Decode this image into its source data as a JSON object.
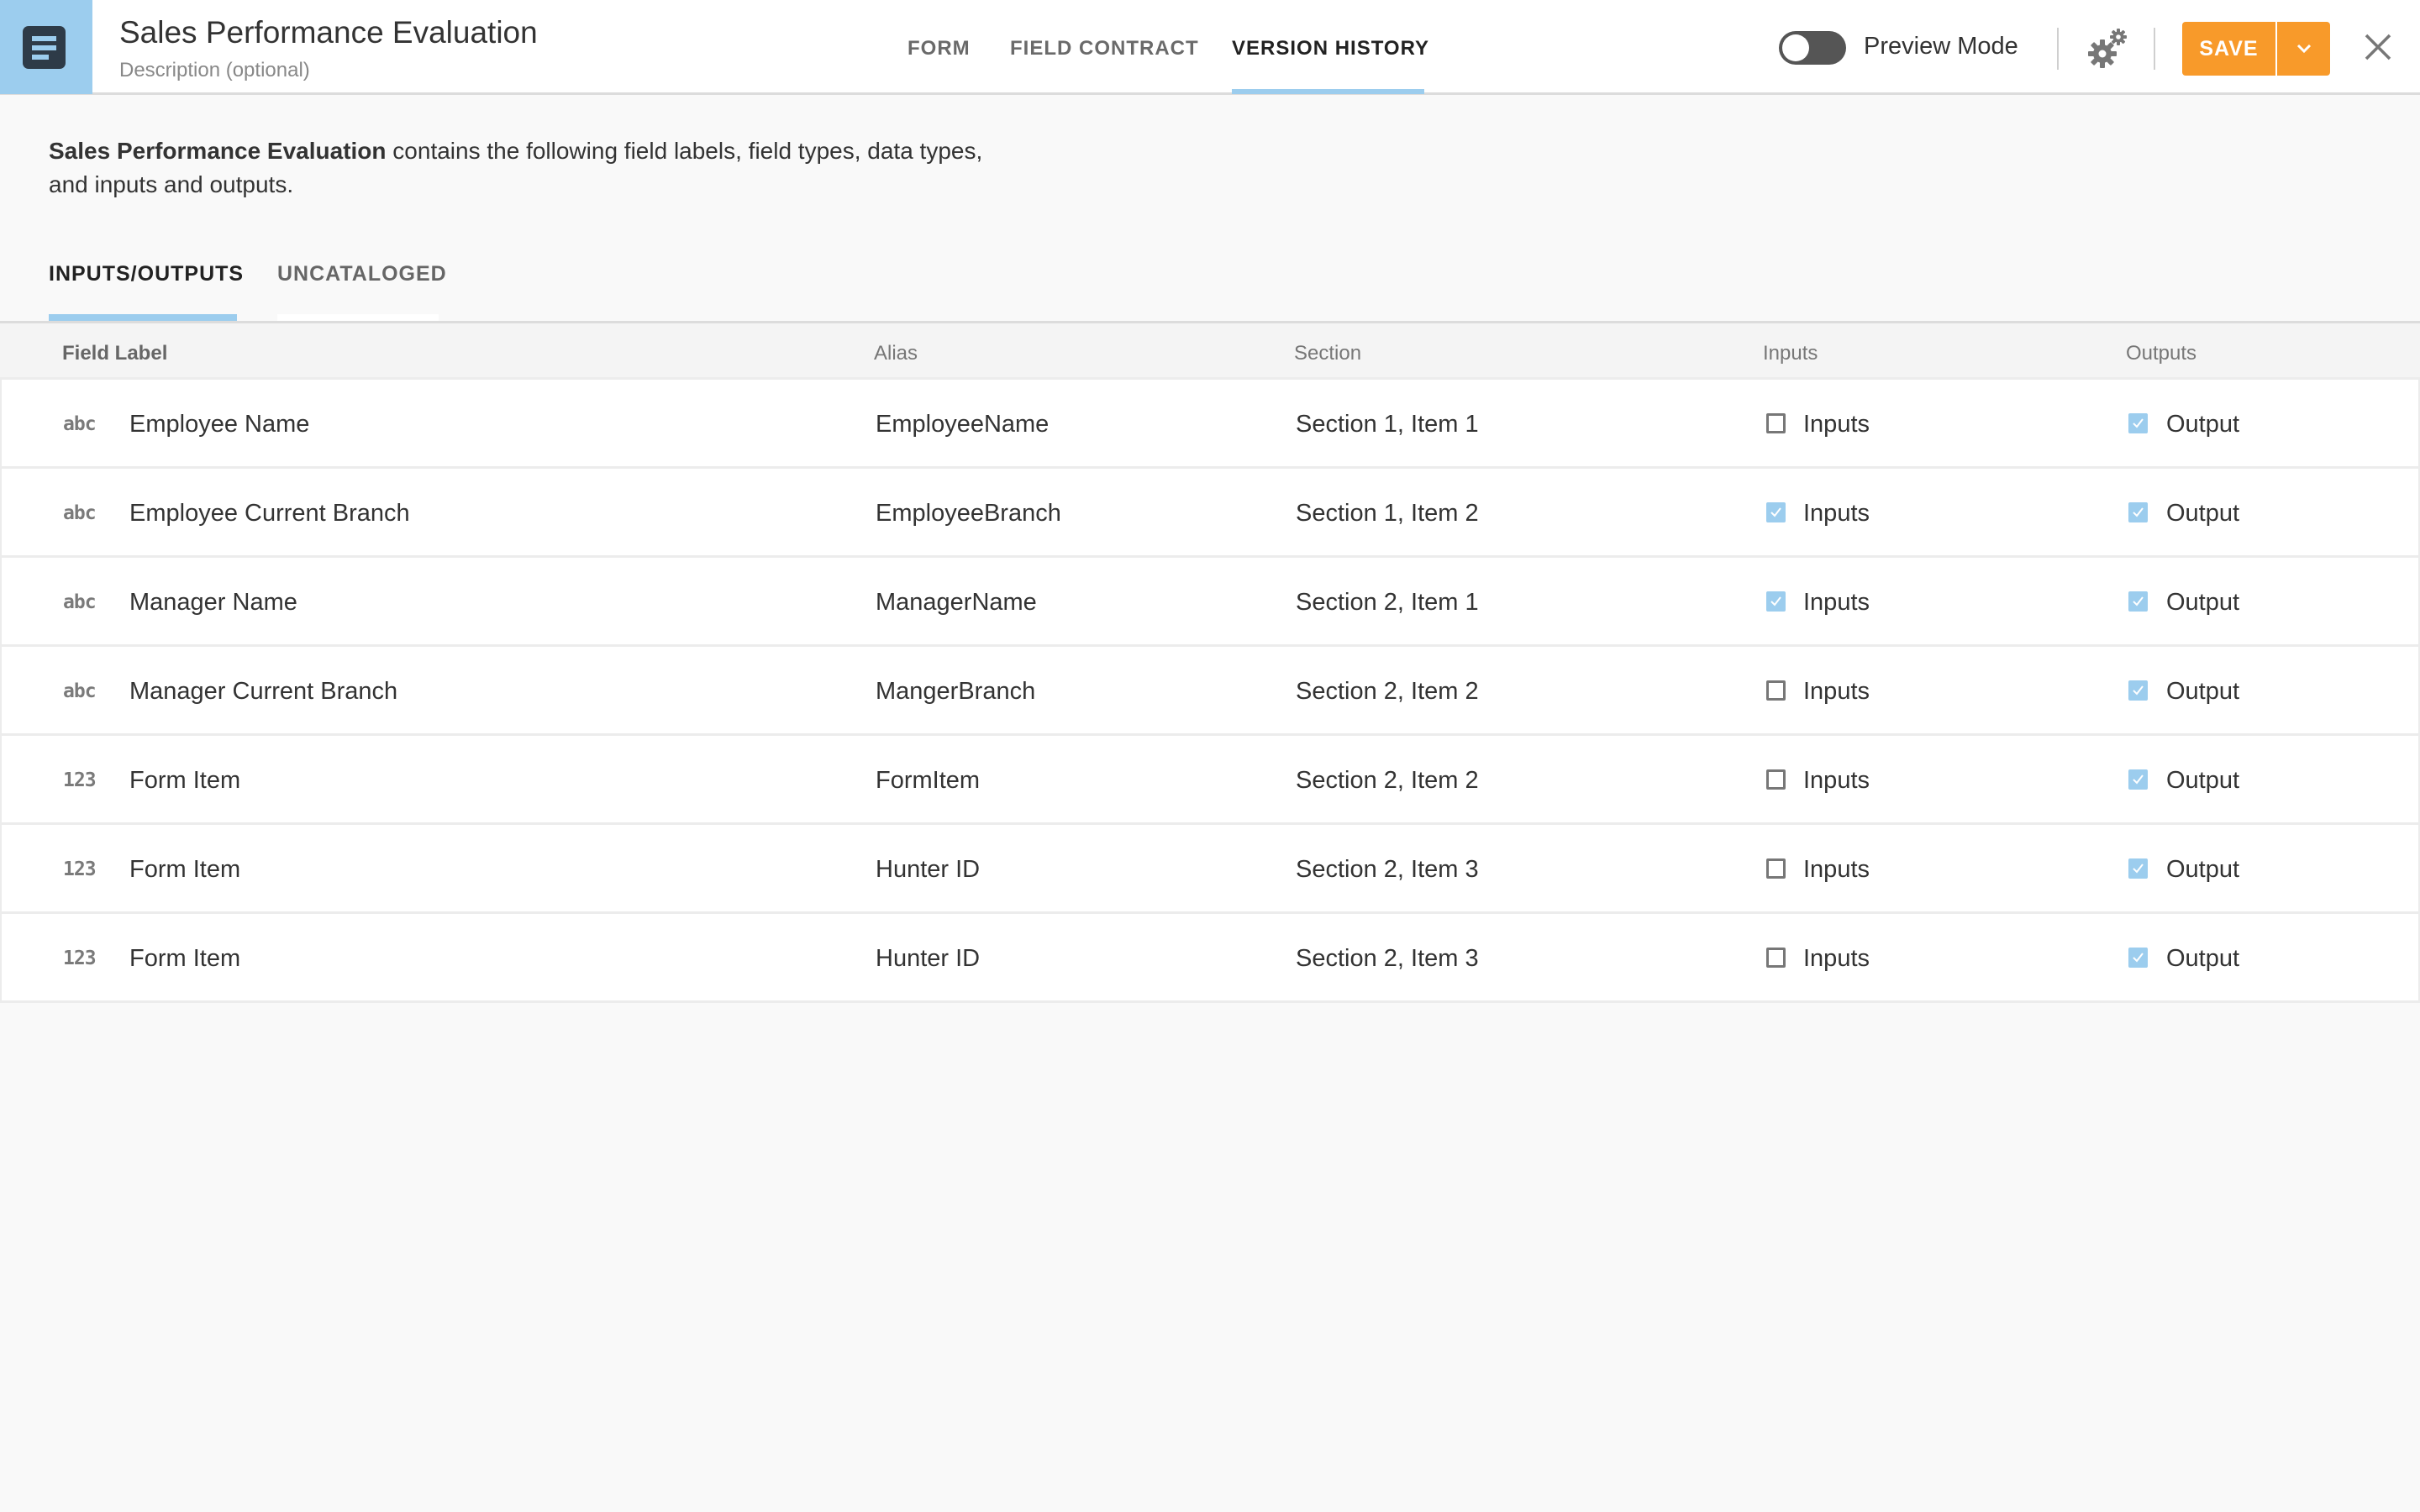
{
  "header": {
    "title": "Sales Performance Evaluation",
    "description_placeholder": "Description (optional)",
    "tabs": [
      {
        "label": "FORM",
        "active": false
      },
      {
        "label": "FIELD CONTRACT",
        "active": false
      },
      {
        "label": "VERSION HISTORY",
        "active": true
      }
    ],
    "preview_mode_label": "Preview Mode",
    "preview_mode_on": false,
    "save_label": "SAVE",
    "icons": {
      "logo": "form-document-icon",
      "settings": "gears-icon",
      "dropdown": "chevron-down-icon",
      "close": "close-icon"
    }
  },
  "summary": {
    "form_name": "Sales Performance Evaluation",
    "text": " contains the following field labels, field types, data types, and inputs and outputs."
  },
  "subtabs": [
    {
      "label": "INPUTS/OUTPUTS",
      "active": true
    },
    {
      "label": "UNCATALOGED",
      "active": false
    }
  ],
  "table": {
    "columns": [
      "Field Label",
      "Alias",
      "Section",
      "Inputs",
      "Outputs"
    ],
    "rows": [
      {
        "type_icon": "abc",
        "type": "text",
        "label": "Employee Name",
        "alias": "EmployeeName",
        "section": "Section 1, Item 1",
        "input_label": "Inputs",
        "input_checked": false,
        "output_label": "Output",
        "output_checked": true
      },
      {
        "type_icon": "abc",
        "type": "text",
        "label": "Employee Current Branch",
        "alias": "EmployeeBranch",
        "section": "Section 1, Item 2",
        "input_label": "Inputs",
        "input_checked": true,
        "output_label": "Output",
        "output_checked": true
      },
      {
        "type_icon": "abc",
        "type": "text",
        "label": "Manager Name",
        "alias": "ManagerName",
        "section": "Section 2, Item 1",
        "input_label": "Inputs",
        "input_checked": true,
        "output_label": "Output",
        "output_checked": true
      },
      {
        "type_icon": "abc",
        "type": "text",
        "label": "Manager Current Branch",
        "alias": "MangerBranch",
        "section": "Section 2, Item 2",
        "input_label": "Inputs",
        "input_checked": false,
        "output_label": "Output",
        "output_checked": true
      },
      {
        "type_icon": "123",
        "type": "number",
        "label": "Form Item",
        "alias": "FormItem",
        "section": "Section 2, Item 2",
        "input_label": "Inputs",
        "input_checked": false,
        "output_label": "Output",
        "output_checked": true
      },
      {
        "type_icon": "123",
        "type": "number",
        "label": "Form Item",
        "alias": "Hunter ID",
        "section": "Section 2, Item 3",
        "input_label": "Inputs",
        "input_checked": false,
        "output_label": "Output",
        "output_checked": true
      },
      {
        "type_icon": "123",
        "type": "number",
        "label": "Form Item",
        "alias": "Hunter ID",
        "section": "Section 2, Item 3",
        "input_label": "Inputs",
        "input_checked": false,
        "output_label": "Output",
        "output_checked": true
      }
    ]
  },
  "colors": {
    "accent": "#9ccdee",
    "save": "#f89a2a",
    "logo_dark": "#2e3b48"
  }
}
